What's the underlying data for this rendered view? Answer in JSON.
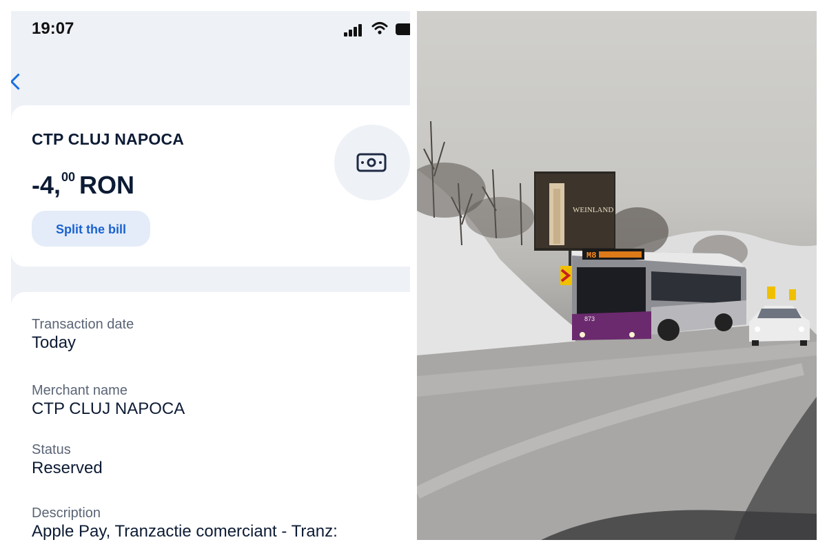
{
  "status_bar": {
    "time": "19:07"
  },
  "transaction": {
    "merchant": "CTP CLUJ NAPOCA",
    "amount_main": "-4,",
    "amount_decimals": "00",
    "currency": "RON",
    "split_label": "Split the bill"
  },
  "details": [
    {
      "label": "Transaction date",
      "value": "Today"
    },
    {
      "label": "Merchant name",
      "value": "CTP CLUJ NAPOCA"
    },
    {
      "label": "Status",
      "value": "Reserved"
    },
    {
      "label": "Description",
      "value": "Apple Pay, Tranzactie comerciant - Tranz:"
    }
  ],
  "photo": {
    "billboard_text": "WEINLAND",
    "bus_display": "M8",
    "bus_number": "873"
  },
  "colors": {
    "accent": "#1a6fe0",
    "text_dark": "#0d1b34",
    "label_gray": "#5a6475",
    "bus_purple": "#6b2a6e"
  },
  "icons": [
    "back-chevron-icon",
    "cash-icon",
    "signal-icon",
    "wifi-icon",
    "battery-icon"
  ]
}
